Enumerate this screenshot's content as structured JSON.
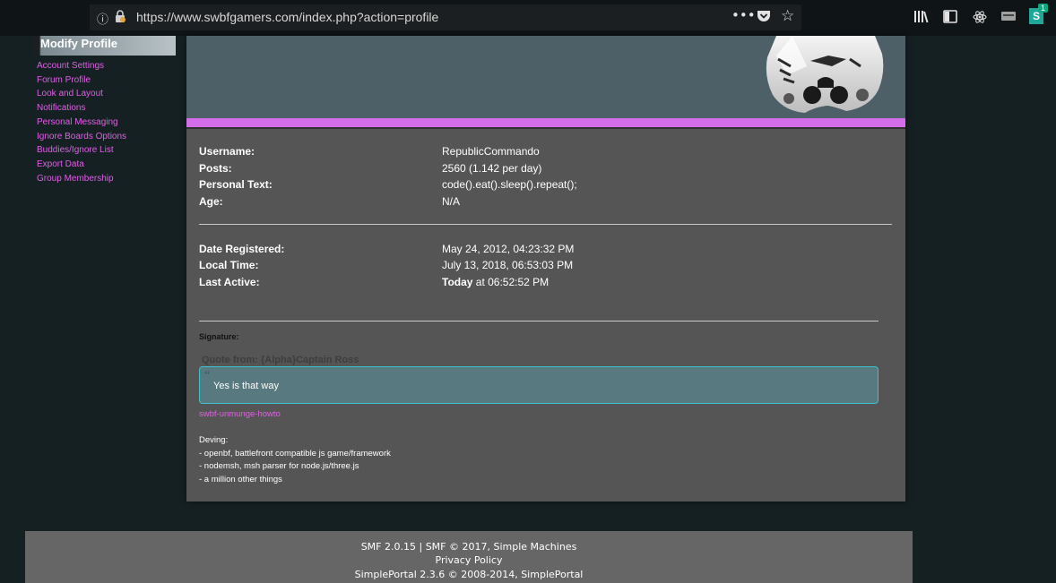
{
  "browser": {
    "url": "https://www.swbfgamers.com/index.php?action=profile",
    "more_icon": "ellipsis-icon",
    "extension_badge": "1",
    "extension_letter": "S"
  },
  "sidebar": {
    "title": "Modify Profile",
    "items": [
      {
        "label": "Account Settings"
      },
      {
        "label": "Forum Profile"
      },
      {
        "label": "Look and Layout"
      },
      {
        "label": "Notifications"
      },
      {
        "label": "Personal Messaging"
      },
      {
        "label": "Ignore Boards Options"
      },
      {
        "label": "Buddies/Ignore List"
      },
      {
        "label": "Export Data"
      },
      {
        "label": "Group Membership"
      }
    ]
  },
  "profile": {
    "fields": [
      {
        "label": "Username:",
        "value": "RepublicCommando"
      },
      {
        "label": "Posts:",
        "value": "2560 (1.142 per day)"
      },
      {
        "label": "Personal Text:",
        "value": "code().eat().sleep().repeat();"
      },
      {
        "label": "Age:",
        "value": "N/A"
      }
    ],
    "dates": [
      {
        "label": "Date Registered:",
        "value": "May 24, 2012, 04:23:32 PM"
      },
      {
        "label": "Local Time:",
        "value": "July 13, 2018, 06:53:03 PM"
      },
      {
        "label": "Last Active:",
        "value_bold": "Today",
        "value": " at 06:52:52 PM"
      }
    ]
  },
  "signature": {
    "label": "Signature:",
    "quote_header": "Quote from: {Alpha}Captain Ross",
    "quote_mark": "“",
    "quote_text": "Yes is that way",
    "link": "swbf-unmunge-howto",
    "lines": [
      "Deving:",
      " - openbf, battlefront compatible js game/framework",
      " - nodemsh, msh parser for node.js/three.js",
      " - a million other things"
    ]
  },
  "footer": {
    "smf": "SMF 2.0.15",
    "sep": " | ",
    "smf_copy": "SMF © 2017, Simple Machines",
    "privacy": "Privacy Policy",
    "portal": "SimplePortal 2.3.6 © 2008-2014, SimplePortal"
  },
  "colors": {
    "accent_link": "#e05ee6",
    "banner": "#4d5f67",
    "pink_bar": "#d46ee8",
    "quote_border": "#3cc3c9"
  }
}
